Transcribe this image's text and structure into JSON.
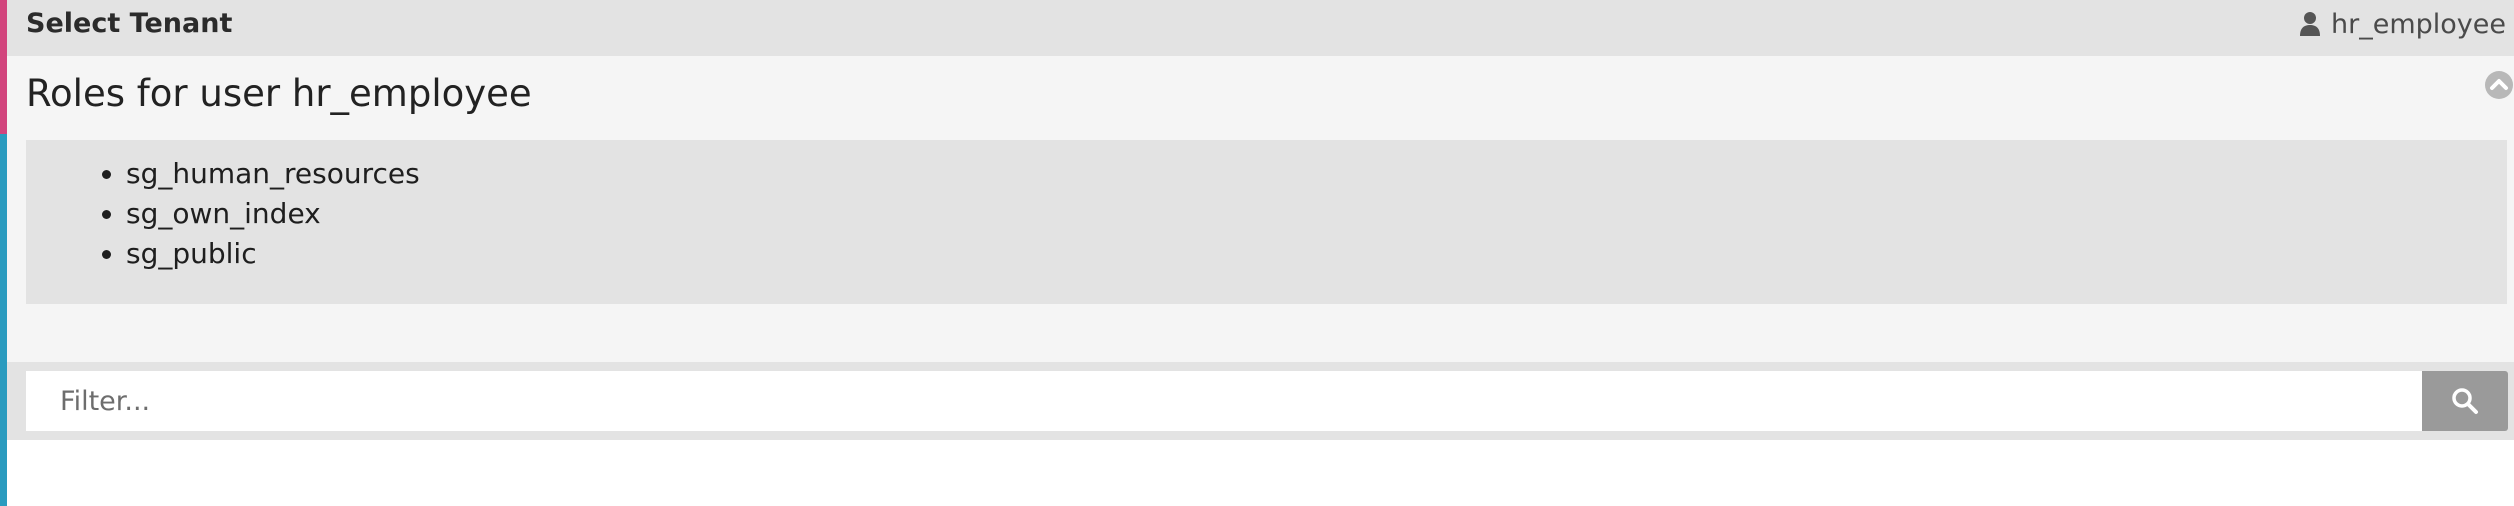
{
  "header": {
    "title": "Select Tenant",
    "username": "hr_employee",
    "user_icon": "user-icon"
  },
  "roles_panel": {
    "title": "Roles for user hr_employee",
    "collapse_icon": "chevron-up-circle-icon",
    "roles": [
      "sg_human_resources",
      "sg_own_index",
      "sg_public"
    ]
  },
  "filter": {
    "placeholder": "Filter...",
    "value": "",
    "search_icon": "search-icon"
  },
  "colors": {
    "accent_top": "#d2457d",
    "accent_bottom": "#2a9bbf",
    "header_bg": "#e3e3e3",
    "panel_bg": "#f5f5f5",
    "search_button_bg": "#9a9a9a"
  }
}
